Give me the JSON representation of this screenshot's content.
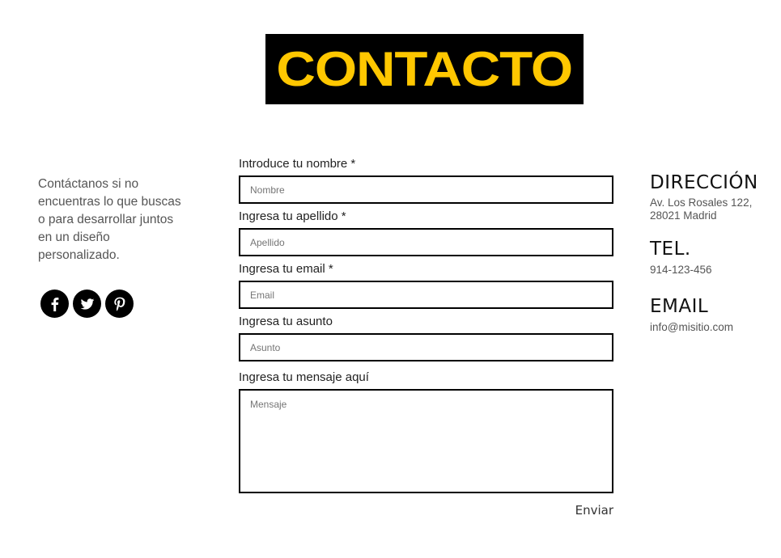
{
  "banner": {
    "title": "CONTACTO",
    "background": "#000000",
    "title_color": "#FFC700"
  },
  "intro": {
    "text": "Contáctanos si no encuentras lo que buscas o para desarrollar juntos en un diseño personalizado."
  },
  "social": [
    {
      "name": "facebook",
      "icon": "facebook-icon"
    },
    {
      "name": "twitter",
      "icon": "twitter-icon"
    },
    {
      "name": "pinterest",
      "icon": "pinterest-icon"
    }
  ],
  "form": {
    "name": {
      "label": "Introduce tu nombre *",
      "placeholder": "Nombre",
      "value": ""
    },
    "surname": {
      "label": "Ingresa tu apellido *",
      "placeholder": "Apellido",
      "value": ""
    },
    "email": {
      "label": "Ingresa tu email *",
      "placeholder": "Email",
      "value": ""
    },
    "subject": {
      "label": "Ingresa tu asunto",
      "placeholder": "Asunto",
      "value": ""
    },
    "message": {
      "label": "Ingresa tu mensaje aquí",
      "placeholder": "Mensaje",
      "value": ""
    },
    "submit_label": "Enviar"
  },
  "contact": {
    "address_heading": "DIRECCIÓN",
    "address_line1": "Av. Los Rosales 122,",
    "address_line2": "28021 Madrid",
    "phone_heading": "TEL.",
    "phone": "914-123-456",
    "email_heading": "EMAIL",
    "email": "info@misitio.com"
  }
}
